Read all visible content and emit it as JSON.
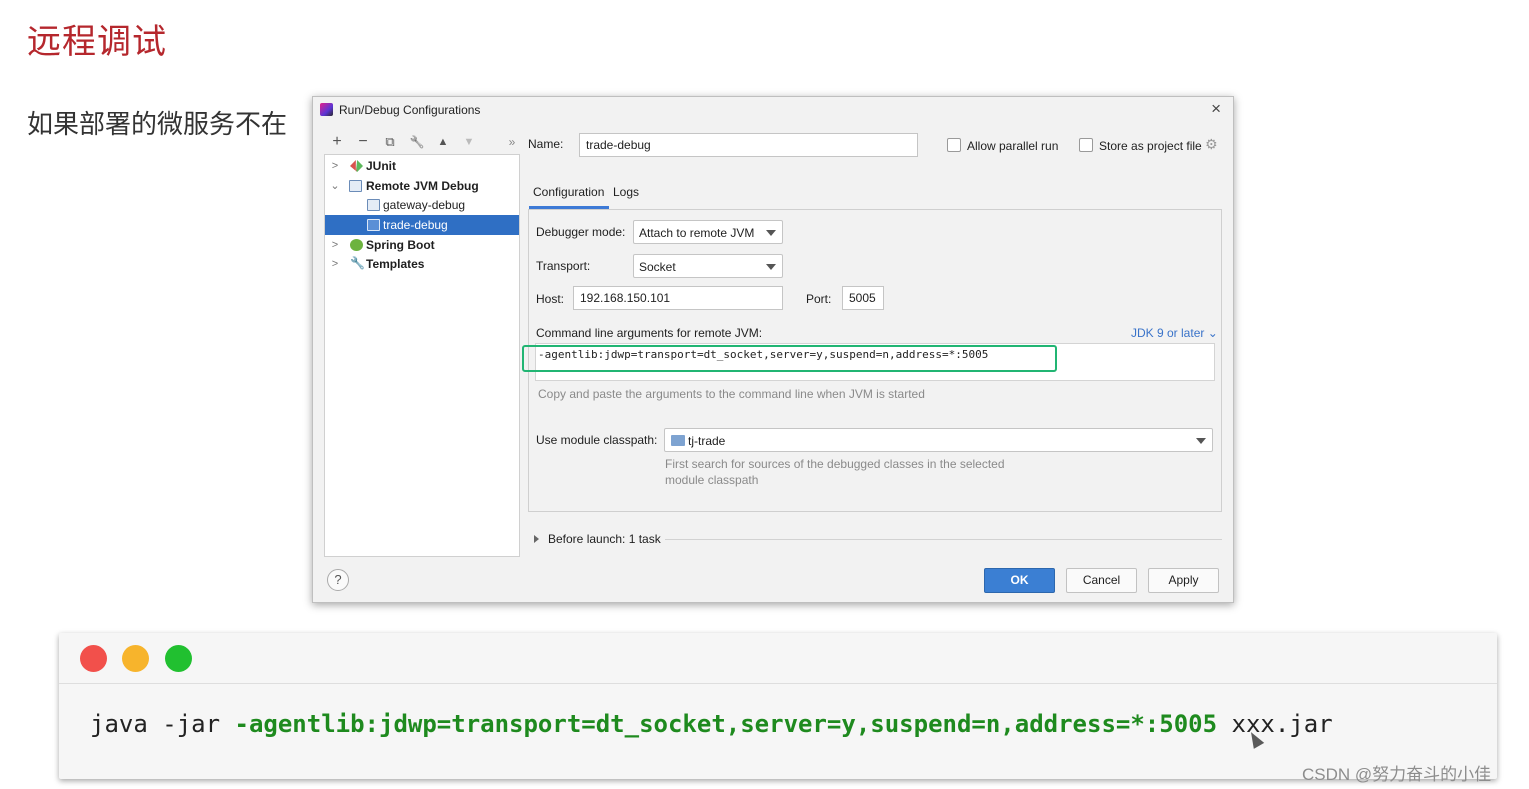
{
  "slide": {
    "title": "远程调试",
    "text": "如果部署的微服务不在"
  },
  "dialog": {
    "title": "Run/Debug Configurations",
    "close": "×",
    "toolbar": {
      "add": "+",
      "remove": "−",
      "copy": "⧉",
      "edit": "🔧",
      "up": "▲",
      "down": "▼",
      "more": "»"
    },
    "tree": [
      {
        "label": "JUnit",
        "icon": "junit-icon"
      },
      {
        "label": "Remote JVM Debug",
        "icon": "remote-debug-icon"
      },
      {
        "label": "gateway-debug",
        "icon": "remote-debug-icon"
      },
      {
        "label": "trade-debug",
        "icon": "remote-debug-icon"
      },
      {
        "label": "Spring Boot",
        "icon": "spring-icon"
      },
      {
        "label": "Templates",
        "icon": "wrench-icon"
      }
    ],
    "name_label": "Name:",
    "name_value": "trade-debug",
    "allow_parallel_label": "Allow parallel run",
    "store_label": "Store as project file",
    "tabs": [
      "Configuration",
      "Logs"
    ],
    "debugger_mode_label": "Debugger mode:",
    "debugger_mode_value": "Attach to remote JVM",
    "transport_label": "Transport:",
    "transport_value": "Socket",
    "host_label": "Host:",
    "host_value": "192.168.150.101",
    "port_label": "Port:",
    "port_value": "5005",
    "cmd_label": "Command line arguments for remote JVM:",
    "jdk_link": "JDK 9 or later ⌄",
    "cmd_value": "-agentlib:jdwp=transport=dt_socket,server=y,suspend=n,address=*:5005",
    "cmd_hint": "Copy and paste the arguments to the command line when JVM is started",
    "module_label": "Use module classpath:",
    "module_value": "tj-trade",
    "module_hint_1": "First search for sources of the debugged classes in the selected",
    "module_hint_2": "module classpath",
    "before_launch": "Before launch: 1 task",
    "help": "?",
    "ok": "OK",
    "cancel": "Cancel",
    "apply": "Apply"
  },
  "terminal": {
    "prefix": "java -jar ",
    "arg": "-agentlib:jdwp=transport=dt_socket,server=y,suspend=n,address=*:5005",
    "suffix": " xxx.jar",
    "dot_colors": [
      "#f2504b",
      "#f7b42c",
      "#21c030"
    ]
  },
  "watermark": "CSDN @努力奋斗的小佳",
  "colors": {
    "title_red": "#b5272d",
    "selection_blue": "#2f6fc4",
    "highlight_green": "#21b573",
    "ok_blue": "#3b7fd3"
  }
}
